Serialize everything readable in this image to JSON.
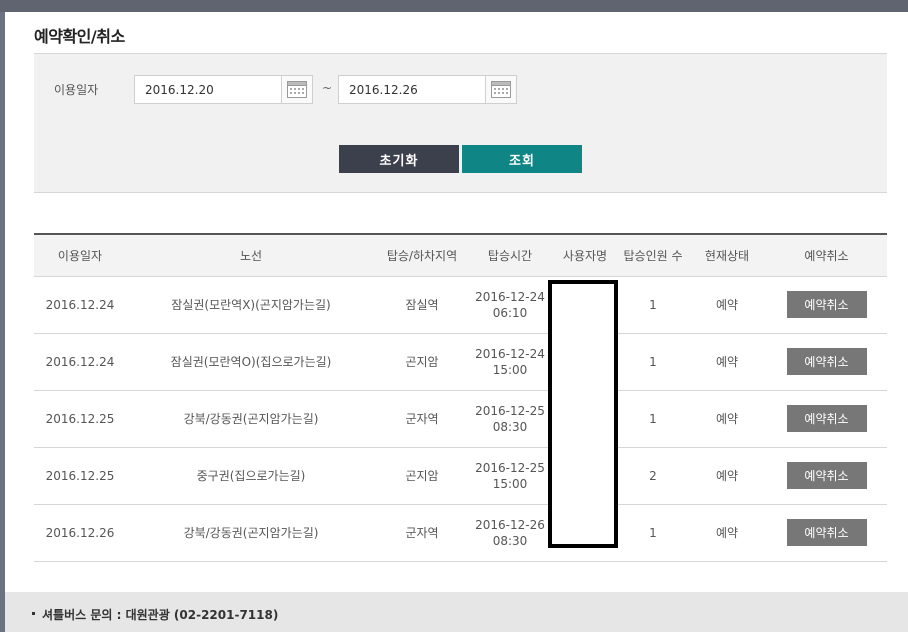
{
  "page": {
    "title": "예약확인/취소"
  },
  "search": {
    "label": "이용일자",
    "start_date": "2016.12.20",
    "separator": "~",
    "end_date": "2016.12.26",
    "reset_label": "초기화",
    "search_label": "조회"
  },
  "table": {
    "headers": [
      "이용일자",
      "노선",
      "탑승/하차지역",
      "탑승시간",
      "사용자명",
      "탑승인원 수",
      "현재상태",
      "예약취소"
    ],
    "rows": [
      {
        "date": "2016.12.24",
        "route": "잠실권(모란역X)(곤지암가는길)",
        "stop": "잠실역",
        "time_date": "2016-12-24",
        "time_clock": "06:10",
        "user": "",
        "count": "1",
        "status": "예약",
        "cancel": "예약취소"
      },
      {
        "date": "2016.12.24",
        "route": "잠실권(모란역O)(집으로가는길)",
        "stop": "곤지암",
        "time_date": "2016-12-24",
        "time_clock": "15:00",
        "user": "",
        "count": "1",
        "status": "예약",
        "cancel": "예약취소"
      },
      {
        "date": "2016.12.25",
        "route": "강북/강동권(곤지암가는길)",
        "stop": "군자역",
        "time_date": "2016-12-25",
        "time_clock": "08:30",
        "user": "",
        "count": "1",
        "status": "예약",
        "cancel": "예약취소"
      },
      {
        "date": "2016.12.25",
        "route": "중구권(집으로가는길)",
        "stop": "곤지암",
        "time_date": "2016-12-25",
        "time_clock": "15:00",
        "user": "",
        "count": "2",
        "status": "예약",
        "cancel": "예약취소"
      },
      {
        "date": "2016.12.26",
        "route": "강북/강동권(곤지암가는길)",
        "stop": "군자역",
        "time_date": "2016-12-26",
        "time_clock": "08:30",
        "user": "",
        "count": "1",
        "status": "예약",
        "cancel": "예약취소"
      }
    ]
  },
  "footer": {
    "text": "셔틀버스 문의 : 대원관광 (02-2201-7118)"
  },
  "icons": {
    "calendar": "calendar-icon"
  },
  "colors": {
    "reset_button": "#3c3f4c",
    "search_button": "#108585",
    "cancel_button": "#777777"
  }
}
